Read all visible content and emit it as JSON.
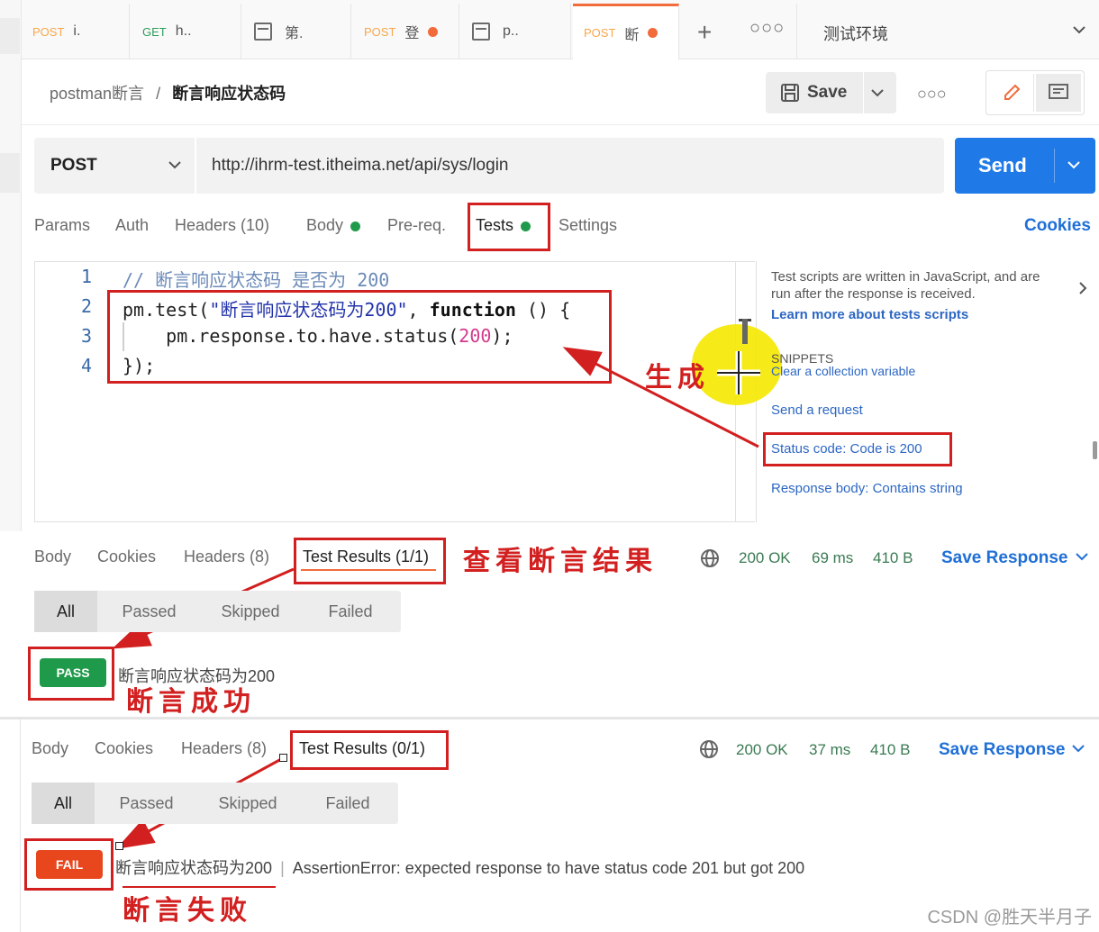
{
  "tabs": [
    {
      "method": "POST",
      "title": "i."
    },
    {
      "method": "GET",
      "title": "h.."
    },
    {
      "method": "",
      "title": "第."
    },
    {
      "method": "POST",
      "title": "登"
    },
    {
      "method": "",
      "title": "p.."
    },
    {
      "method": "POST",
      "title": "断"
    }
  ],
  "environment": "测试环境",
  "breadcrumb": {
    "parent": "postman断言",
    "separator": "/",
    "current": "断言响应状态码"
  },
  "toolbar": {
    "save_label": "Save"
  },
  "request": {
    "method": "POST",
    "url": "http://ihrm-test.itheima.net/api/sys/login",
    "send_label": "Send"
  },
  "request_tabs": [
    "Params",
    "Auth",
    "Headers (10)",
    "Body",
    "Pre-req.",
    "Tests",
    "Settings"
  ],
  "cookies_label": "Cookies",
  "editor": {
    "line_numbers": [
      "1",
      "2",
      "3",
      "4"
    ],
    "line1": "// 断言响应状态码 是否为 200",
    "line2_a": "pm.test(",
    "line2_str": "\"断言响应状态码为200\"",
    "line2_b": ", ",
    "line2_kw": "function",
    "line2_c": " () {",
    "line3_a": "    pm.response.to.have.status(",
    "line3_num": "200",
    "line3_b": ");",
    "line4": "});"
  },
  "side": {
    "info": "Test scripts are written in JavaScript, and are run after the response is received.",
    "learn_more": "Learn more about tests scripts",
    "snippets_heading": "SNIPPETS",
    "snippets": [
      "Clear a collection variable",
      "Send a request",
      "Status code: Code is 200",
      "Response body: Contains string"
    ]
  },
  "response1": {
    "tabs": [
      "Body",
      "Cookies",
      "Headers (8)",
      "Test Results (1/1)"
    ],
    "status": "200 OK",
    "time": "69 ms",
    "size": "410 B",
    "save_response": "Save Response",
    "filters": [
      "All",
      "Passed",
      "Skipped",
      "Failed"
    ],
    "result_badge": "PASS",
    "result_text": "断言响应状态码为200"
  },
  "response2": {
    "tabs": [
      "Body",
      "Cookies",
      "Headers (8)",
      "Test Results (0/1)"
    ],
    "status": "200 OK",
    "time": "37 ms",
    "size": "410 B",
    "save_response": "Save Response",
    "filters": [
      "All",
      "Passed",
      "Skipped",
      "Failed"
    ],
    "result_badge": "FAIL",
    "result_text": "断言响应状态码为200",
    "error_text": "AssertionError: expected response to have status code 201 but got 200"
  },
  "annotations": {
    "generate": "生成",
    "view_results": "查看断言结果",
    "success": "断言成功",
    "failure": "断言失败"
  },
  "watermark": "CSDN @胜天半月子",
  "colors": {
    "accent": "#f26b3a",
    "send": "#1f7ae8",
    "pass": "#1f9a4a",
    "fail": "#e8471d",
    "annotation": "#d21f1f"
  }
}
